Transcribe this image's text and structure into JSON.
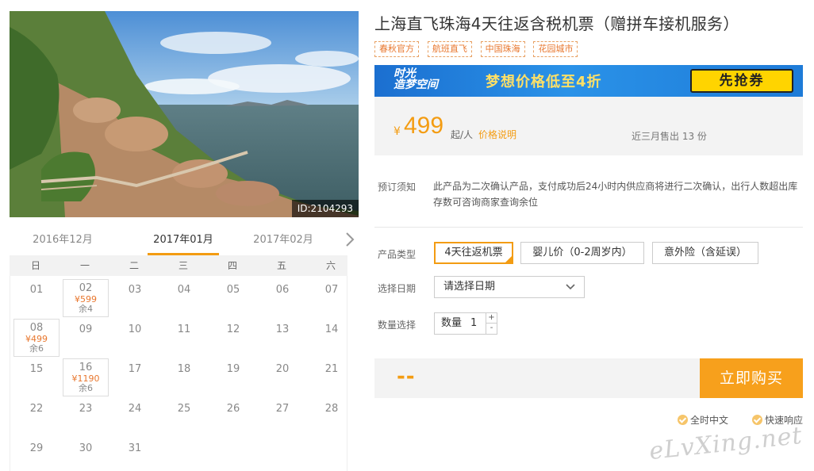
{
  "photo": {
    "id_label": "ID:2104293"
  },
  "calendar": {
    "months": [
      "2016年12月",
      "2017年01月",
      "2017年02月"
    ],
    "active_month_index": 1,
    "weekdays": [
      "日",
      "一",
      "二",
      "三",
      "四",
      "五",
      "六"
    ],
    "weeks": [
      [
        {
          "d": "01"
        },
        {
          "d": "02",
          "price": "¥599",
          "remain": "余4"
        },
        {
          "d": "03"
        },
        {
          "d": "04"
        },
        {
          "d": "05"
        },
        {
          "d": "06"
        },
        {
          "d": "07"
        }
      ],
      [
        {
          "d": "08",
          "price": "¥499",
          "remain": "余6"
        },
        {
          "d": "09"
        },
        {
          "d": "10"
        },
        {
          "d": "11"
        },
        {
          "d": "12"
        },
        {
          "d": "13"
        },
        {
          "d": "14"
        }
      ],
      [
        {
          "d": "15"
        },
        {
          "d": "16",
          "price": "¥1190",
          "remain": "余6"
        },
        {
          "d": "17"
        },
        {
          "d": "18"
        },
        {
          "d": "19"
        },
        {
          "d": "20"
        },
        {
          "d": "21"
        }
      ],
      [
        {
          "d": "22"
        },
        {
          "d": "23"
        },
        {
          "d": "24"
        },
        {
          "d": "25"
        },
        {
          "d": "26"
        },
        {
          "d": "27"
        },
        {
          "d": "28"
        }
      ],
      [
        {
          "d": "29"
        },
        {
          "d": "30"
        },
        {
          "d": "31"
        }
      ]
    ]
  },
  "product": {
    "title": "上海直飞珠海4天往返含税机票（赠拼车接机服务）",
    "tags": [
      "春秋官方",
      "航班直飞",
      "中国珠海",
      "花园城市"
    ]
  },
  "banner": {
    "logo_line1": "时光",
    "logo_line2": "造梦空间",
    "slogan": "梦想价格低至4折",
    "button": "先抢券"
  },
  "price": {
    "currency": "¥",
    "amount": "499",
    "unit": "起/人",
    "explain_link": "价格说明",
    "sold": "近三月售出 13 份"
  },
  "notice": {
    "label": "预订须知",
    "text": "此产品为二次确认产品，支付成功后24小时内供应商将进行二次确认，出行人数超出库存数可咨询商家查询余位"
  },
  "options": {
    "type_label": "产品类型",
    "types": [
      "4天往返机票",
      "婴儿价（0-2周岁内）",
      "意外险（含延误）"
    ],
    "selected_type_index": 0,
    "date_label": "选择日期",
    "date_placeholder": "请选择日期",
    "qty_label": "数量选择",
    "qty_inner_label": "数量",
    "qty_value": "1",
    "qty_plus": "+",
    "qty_minus": "-"
  },
  "purchase": {
    "total_placeholder": "--",
    "buy_label": "立即购买"
  },
  "services": [
    "全时中文",
    "快速响应"
  ],
  "watermark": "eLvXing.net",
  "colors": {
    "accent": "#f39c12",
    "banner_blue": "#1e7bd8",
    "banner_button": "#ffd400"
  }
}
